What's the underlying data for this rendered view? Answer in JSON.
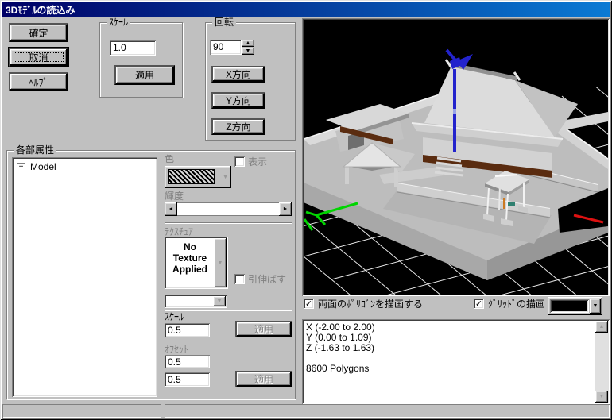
{
  "window": {
    "title": "3Dﾓﾃﾞﾙの読込み"
  },
  "left_buttons": {
    "confirm": "確定",
    "cancel": "取消",
    "help": "ﾍﾙﾌﾟ"
  },
  "scale_group": {
    "label": "ｽｹｰﾙ",
    "value": "1.0",
    "apply_label": "適用"
  },
  "rotation_group": {
    "label": "回転",
    "angle_value": "90",
    "x_label": "X方向",
    "y_label": "Y方向",
    "z_label": "Z方向"
  },
  "attributes_group": {
    "label": "各部属性",
    "tree_root": "Model",
    "color_label": "色",
    "show_label": "表示",
    "brightness_label": "輝度",
    "texture_label": "ﾃｸｽﾁｭｱ",
    "texture_value": "No Texture Applied",
    "stretch_label": "引伸ばす",
    "scale_label": "ｽｹｰﾙ",
    "scale_value": "0.5",
    "apply_label": "適用",
    "offset_label": "ｵﾌｾｯﾄ",
    "offset_value_1": "0.5",
    "offset_value_2": "0.5"
  },
  "viewport_controls": {
    "both_sides_label": "両面のﾎﾟﾘｺﾞﾝを描画する",
    "both_sides_checked": true,
    "grid_label": "ｸﾞﾘｯﾄﾞの描画",
    "grid_checked": true,
    "grid_color": "#000000"
  },
  "scene": {
    "background": "#000000",
    "grid_line_color": "#e8e8e8",
    "x_axis_color": "#dd1111",
    "y_axis_color": "#2323cc",
    "z_axis_color": "#00d500"
  },
  "info_panel": {
    "lines": [
      "X (-2.00 to 2.00)",
      "Y (0.00 to 1.09)",
      "Z (-1.63 to 1.63)",
      "",
      "8600 Polygons"
    ]
  }
}
